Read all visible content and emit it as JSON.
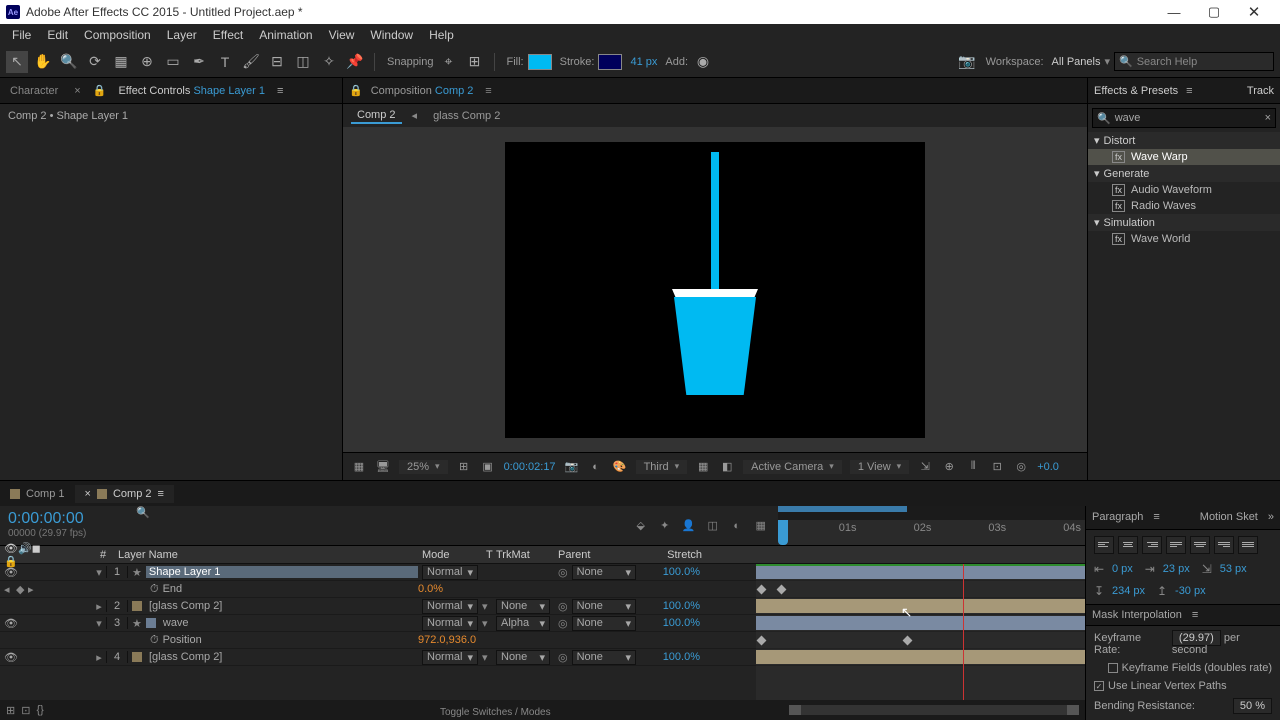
{
  "titlebar": {
    "app": "Adobe After Effects CC 2015 - Untitled Project.aep *"
  },
  "menu": [
    "File",
    "Edit",
    "Composition",
    "Layer",
    "Effect",
    "Animation",
    "View",
    "Window",
    "Help"
  ],
  "toolbar": {
    "snapping": "Snapping",
    "fill_label": "Fill:",
    "stroke_label": "Stroke:",
    "stroke_px": "41 px",
    "add_label": "Add:",
    "workspace_label": "Workspace:",
    "workspace_value": "All Panels",
    "search_placeholder": "Search Help"
  },
  "effect_controls": {
    "tab_char": "Character",
    "tab_fx": "Effect Controls",
    "layer": "Shape Layer 1",
    "path": "Comp 2 • Shape Layer 1"
  },
  "composition": {
    "label": "Composition",
    "name": "Comp 2",
    "crumb": [
      "Comp 2",
      "glass Comp 2"
    ]
  },
  "comp_footer": {
    "zoom": "25%",
    "timecode": "0:00:02:17",
    "res": "Third",
    "camera": "Active Camera",
    "view": "1 View",
    "exposure": "+0.0"
  },
  "effects_panel": {
    "title": "Effects & Presets",
    "tab2": "Track",
    "search": "wave",
    "groups": [
      {
        "name": "Distort",
        "items": [
          {
            "name": "Wave Warp",
            "sel": true
          }
        ]
      },
      {
        "name": "Generate",
        "items": [
          {
            "name": "Audio Waveform"
          },
          {
            "name": "Radio Waves"
          }
        ]
      },
      {
        "name": "Simulation",
        "items": [
          {
            "name": "Wave World"
          }
        ]
      }
    ]
  },
  "timeline_tabs": [
    {
      "label": "Comp 1",
      "active": false
    },
    {
      "label": "Comp 2",
      "active": true
    }
  ],
  "timeline": {
    "timecode": "0:00:00:00",
    "fps": "00000 (29.97 fps)",
    "ruler": [
      "01s",
      "02s",
      "03s",
      "04s"
    ],
    "cols": {
      "layer": "Layer Name",
      "mode": "Mode",
      "t": "T",
      "trk": "TrkMat",
      "parent": "Parent",
      "stretch": "Stretch"
    },
    "layers": [
      {
        "idx": "1",
        "name": "Shape Layer 1",
        "mode": "Normal",
        "trk": "",
        "parent": "None",
        "stretch": "100.0%",
        "sel": true,
        "star": true,
        "open": true,
        "bar": "shape",
        "props": [
          {
            "name": "End",
            "val": "0.0%",
            "kf": true
          }
        ]
      },
      {
        "idx": "2",
        "name": "[glass Comp 2]",
        "mode": "Normal",
        "trk": "None",
        "parent": "None",
        "stretch": "100.0%",
        "bar": "glass",
        "pre": true
      },
      {
        "idx": "3",
        "name": "wave",
        "mode": "Normal",
        "trk": "Alpha",
        "parent": "None",
        "stretch": "100.0%",
        "star": true,
        "open": true,
        "bar": "wave",
        "props": [
          {
            "name": "Position",
            "val": "972.0,936.0",
            "kf": true
          }
        ]
      },
      {
        "idx": "4",
        "name": "[glass Comp 2]",
        "mode": "Normal",
        "trk": "None",
        "parent": "None",
        "stretch": "100.0%",
        "bar": "glass",
        "pre": true
      }
    ],
    "toggle_label": "Toggle Switches / Modes"
  },
  "paragraph": {
    "title": "Paragraph",
    "tab2": "Motion Sket",
    "inputs": [
      {
        "ic": "⇤",
        "v": "0 px"
      },
      {
        "ic": "⇥",
        "v": "23 px"
      },
      {
        "ic": "⇲",
        "v": "53 px"
      },
      {
        "ic": "↧",
        "v": "234 px"
      },
      {
        "ic": "↥",
        "v": "-30 px"
      }
    ]
  },
  "mask": {
    "title": "Mask Interpolation",
    "rate_label": "Keyframe Rate:",
    "rate_val": "(29.97)",
    "rate_unit": "per second",
    "fields": "Keyframe Fields (doubles rate)",
    "linear": "Use Linear Vertex Paths",
    "bending_label": "Bending Resistance:",
    "bending_val": "50 %"
  }
}
